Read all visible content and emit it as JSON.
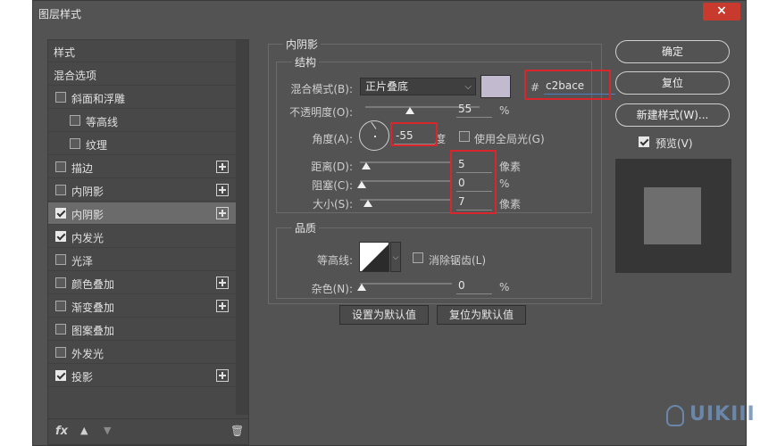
{
  "window": {
    "title": "图层样式",
    "close": "×"
  },
  "style_list": {
    "items": [
      {
        "label": "样式",
        "checkbox": false,
        "checked": false,
        "plus": false,
        "selected": false,
        "indent": 0
      },
      {
        "label": "混合选项",
        "checkbox": false,
        "checked": false,
        "plus": false,
        "selected": false,
        "indent": 0
      },
      {
        "label": "斜面和浮雕",
        "checkbox": true,
        "checked": false,
        "plus": false,
        "selected": false,
        "indent": 0
      },
      {
        "label": "等高线",
        "checkbox": true,
        "checked": false,
        "plus": false,
        "selected": false,
        "indent": 1
      },
      {
        "label": "纹理",
        "checkbox": true,
        "checked": false,
        "plus": false,
        "selected": false,
        "indent": 1
      },
      {
        "label": "描边",
        "checkbox": true,
        "checked": false,
        "plus": true,
        "selected": false,
        "indent": 0
      },
      {
        "label": "内阴影",
        "checkbox": true,
        "checked": false,
        "plus": true,
        "selected": false,
        "indent": 0
      },
      {
        "label": "内阴影",
        "checkbox": true,
        "checked": true,
        "plus": true,
        "selected": true,
        "indent": 0
      },
      {
        "label": "内发光",
        "checkbox": true,
        "checked": true,
        "plus": false,
        "selected": false,
        "indent": 0
      },
      {
        "label": "光泽",
        "checkbox": true,
        "checked": false,
        "plus": false,
        "selected": false,
        "indent": 0
      },
      {
        "label": "颜色叠加",
        "checkbox": true,
        "checked": false,
        "plus": true,
        "selected": false,
        "indent": 0
      },
      {
        "label": "渐变叠加",
        "checkbox": true,
        "checked": false,
        "plus": true,
        "selected": false,
        "indent": 0
      },
      {
        "label": "图案叠加",
        "checkbox": true,
        "checked": false,
        "plus": false,
        "selected": false,
        "indent": 0
      },
      {
        "label": "外发光",
        "checkbox": true,
        "checked": false,
        "plus": false,
        "selected": false,
        "indent": 0
      },
      {
        "label": "投影",
        "checkbox": true,
        "checked": true,
        "plus": true,
        "selected": false,
        "indent": 0
      }
    ],
    "bottom": {
      "fx": "fx",
      "up": "▲",
      "down": "▼",
      "trash": "🗑"
    }
  },
  "inner_shadow": {
    "title": "内阴影",
    "structure": {
      "title": "结构",
      "blend_mode_label": "混合模式(B):",
      "blend_mode_value": "正片叠底",
      "color_swatch": "#c2bace",
      "hex_prefix": "#",
      "hex_value": "c2bace",
      "opacity_label": "不透明度(O):",
      "opacity_value": "55",
      "opacity_unit": "%",
      "opacity_level": 0.55,
      "angle_label": "角度(A):",
      "angle_value": "-55",
      "angle_unit": "度",
      "global_light_label": "使用全局光(G)",
      "distance_label": "距离(D):",
      "distance_value": "5",
      "distance_unit": "像素",
      "choke_label": "阻塞(C):",
      "choke_value": "0",
      "choke_unit": "%",
      "size_label": "大小(S):",
      "size_value": "7",
      "size_unit": "像素"
    },
    "quality": {
      "title": "品质",
      "contour_label": "等高线:",
      "anti_alias_label": "消除锯齿(L)",
      "noise_label": "杂色(N):",
      "noise_value": "0",
      "noise_unit": "%"
    },
    "buttons": {
      "make_default": "设置为默认值",
      "reset_default": "复位为默认值"
    }
  },
  "right_panel": {
    "ok": "确定",
    "reset": "复位",
    "new_style": "新建样式(W)...",
    "preview_label": "预览(V)",
    "preview_checked": true
  },
  "watermark": "UIKIII"
}
